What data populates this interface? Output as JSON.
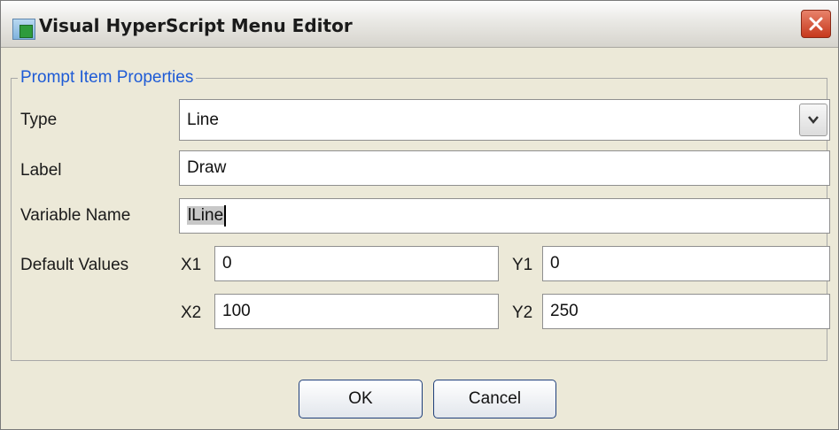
{
  "window": {
    "title": "Visual HyperScript Menu Editor"
  },
  "group": {
    "legend": "Prompt Item Properties"
  },
  "type": {
    "label": "Type",
    "value": "Line"
  },
  "label": {
    "label": "Label",
    "value": "Draw"
  },
  "variable": {
    "label": "Variable Name",
    "value": "lLine"
  },
  "defaults": {
    "label": "Default Values",
    "x1": {
      "label": "X1",
      "value": "0"
    },
    "y1": {
      "label": "Y1",
      "value": "0"
    },
    "x2": {
      "label": "X2",
      "value": "100"
    },
    "y2": {
      "label": "Y2",
      "value": "250"
    }
  },
  "buttons": {
    "ok": "OK",
    "cancel": "Cancel"
  },
  "icons": {
    "app": "app-icon",
    "close": "close-icon",
    "dropdown": "chevron-down-icon"
  }
}
